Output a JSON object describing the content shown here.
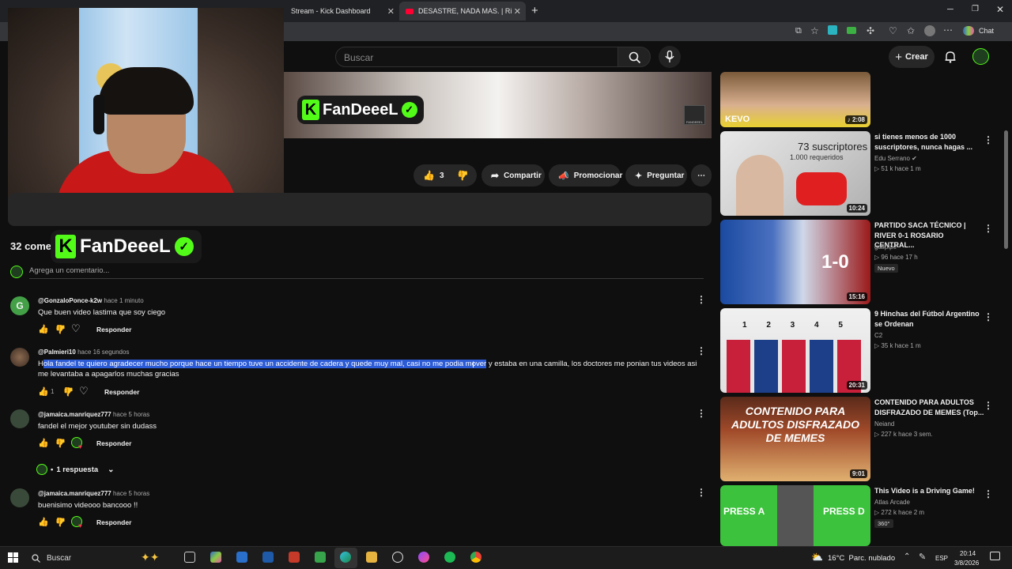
{
  "browser": {
    "tabs": [
      {
        "label": "Stream - Kick Dashboard"
      },
      {
        "label": "DESASTRE, NADA MAS. | River Pla"
      }
    ],
    "chat_label": "Chat"
  },
  "youtube": {
    "search_placeholder": "Buscar",
    "create_label": "Crear"
  },
  "overlay": {
    "brand": "FanDeeeL",
    "watermark_small": "FANDEEEL"
  },
  "actions": {
    "like_count": "3",
    "share": "Compartir",
    "promote": "Promocionar",
    "ask": "Preguntar"
  },
  "comments_header": {
    "count_label": "32 come",
    "add_placeholder": "Agrega un comentario..."
  },
  "comments": [
    {
      "author": "@GonzaloPonce-k2w",
      "time": "hace 1 minuto",
      "text": "Que buen video lastima que soy ciego",
      "likes": "",
      "reply": "Responder",
      "avatar_letter": "G",
      "avatar_color": "#43a047"
    },
    {
      "author": "@Palmieri10",
      "time": "hace 16 segundos",
      "text_first": "H",
      "text_selected": "ola fandel te quiero agradecer mucho porque hace un tiempo tuve un accidente de cadera y quede muy mal, casi no me podia mover",
      "text_rest": " y estaba en una camilla, los doctores me ponian tus videos asi me levantaba a apagarlos muchas gracias",
      "likes": "1",
      "reply": "Responder"
    },
    {
      "author": "@jamaica.manriquez777",
      "time": "hace 5 horas",
      "text": "fandel el mejor youtuber sin dudass",
      "reply": "Responder",
      "replies_label": "1 respuesta"
    },
    {
      "author": "@jamaica.manriquez777",
      "time": "hace 5 horas",
      "text": "buenisimo videooo bancooo !!",
      "reply": "Responder"
    }
  ],
  "sidebar": [
    {
      "title": "",
      "channel": "",
      "meta": "",
      "duration": "2:08",
      "thumb_text": "KEVO"
    },
    {
      "title": "si tienes menos de 1000 suscriptores, nunca hagas ...",
      "channel": "Edu Serrano",
      "meta": "51 k   hace 1 m",
      "duration": "10:24",
      "thumb_text": "73 suscriptores",
      "thumb_sub": "1.000 requeridos"
    },
    {
      "title": "PARTIDO SACA TÉCNICO | RIVER 0-1 ROSARIO CENTRAL...",
      "channel": "gaspipe",
      "meta": "96   hace 17 h",
      "badge": "Nuevo",
      "duration": "15:16",
      "thumb_text": "1-0"
    },
    {
      "title": "9 Hinchas del Fútbol Argentino se Ordenan",
      "channel": "C2",
      "meta": "35 k   hace 1 m",
      "duration": "20:31",
      "thumb_text": "1 2 3 4 5"
    },
    {
      "title": "CONTENIDO PARA ADULTOS DISFRAZADO DE MEMES (Top...",
      "channel": "Neiand",
      "meta": "227 k   hace 3 sem.",
      "duration": "9:01",
      "thumb_text": "CONTENIDO PARA ADULTOS DISFRAZADO DE MEMES"
    },
    {
      "title": "This Video is a Driving Game!",
      "channel": "Atlas Arcade",
      "meta": "272 k   hace 2 m",
      "badge": "360°",
      "duration": "",
      "thumb_text": "PRESS A",
      "thumb_text2": "PRESS D"
    }
  ],
  "taskbar": {
    "search": "Buscar",
    "weather": "16°C  Parc. nublado",
    "lang": "ESP",
    "time": "20:14",
    "date": "3/8/2026"
  }
}
